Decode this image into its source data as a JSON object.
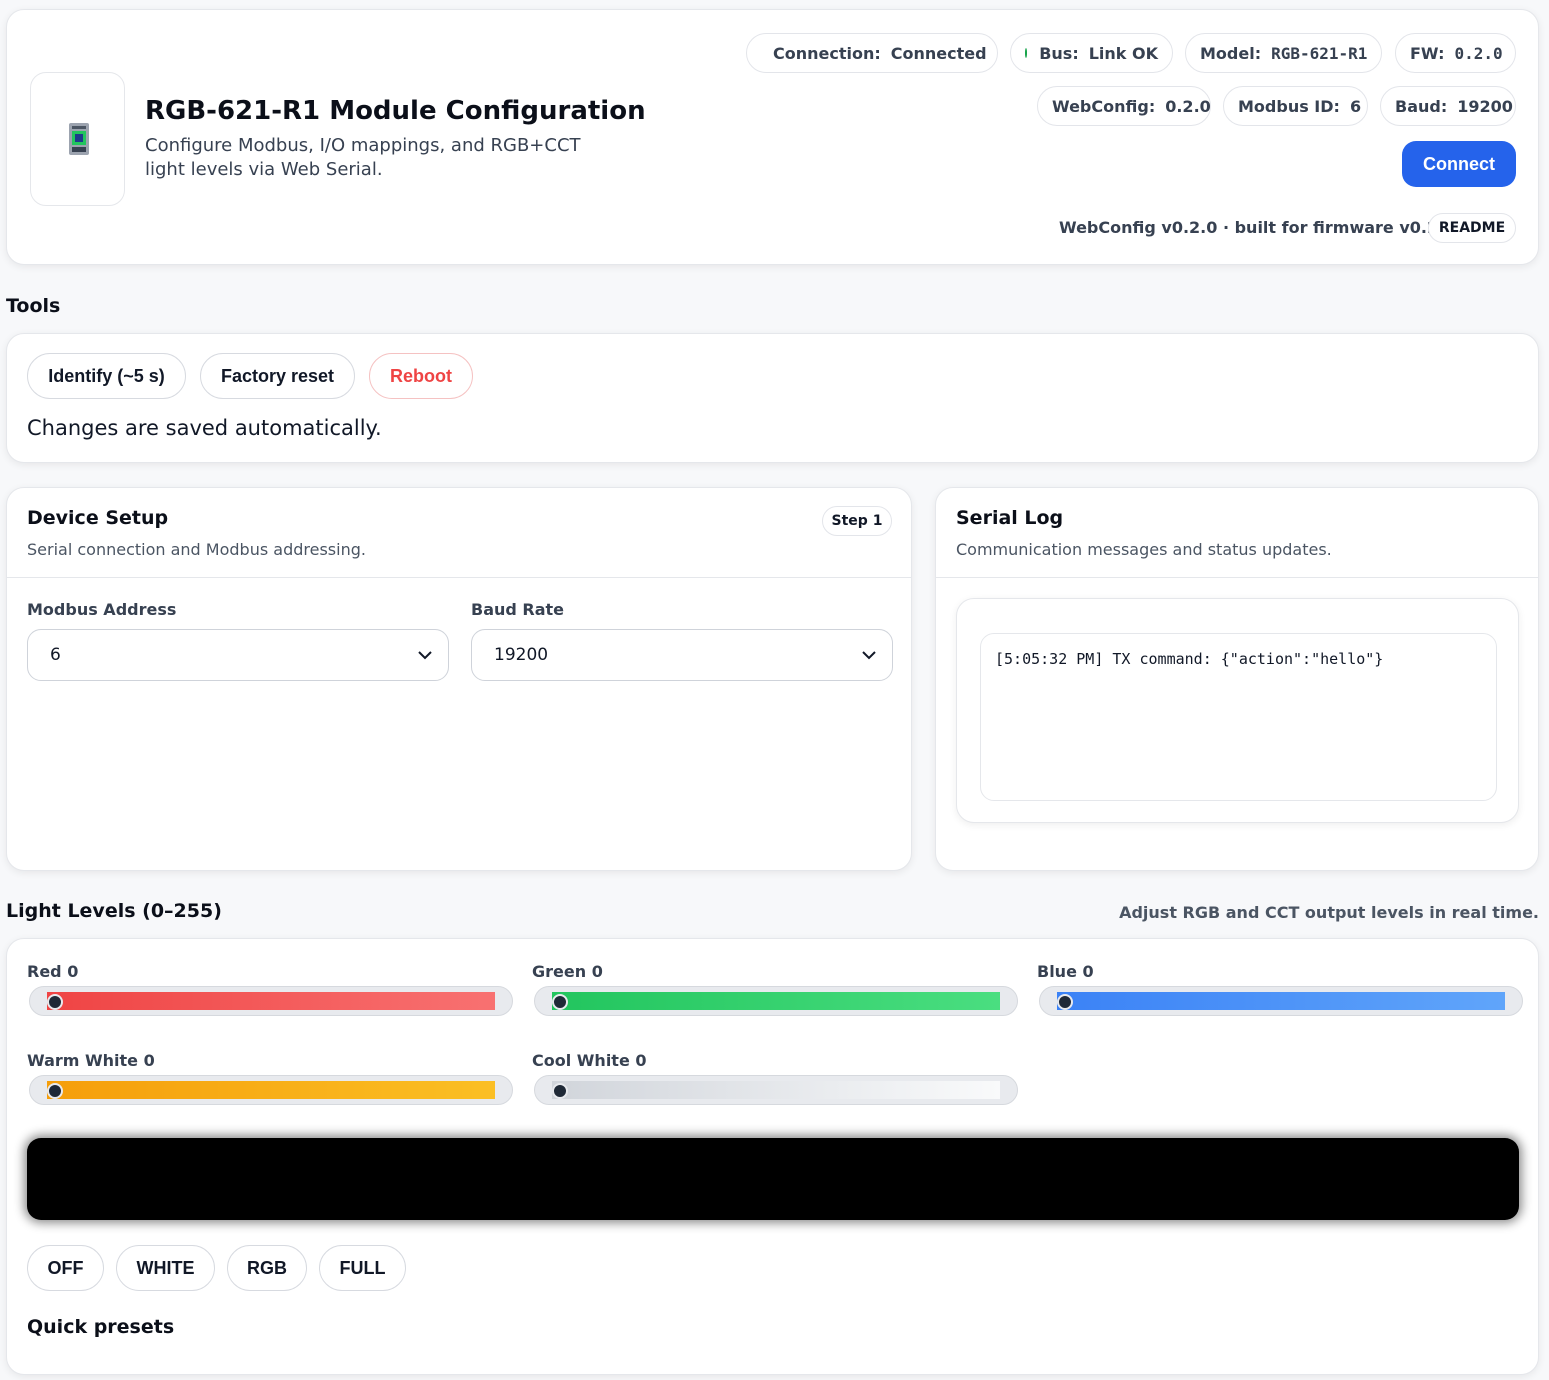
{
  "header": {
    "title": "RGB-621-R1 Module Configuration",
    "subtitle_line1": "Configure Modbus, I/O mappings, and RGB+CCT",
    "subtitle_line2": "light levels via Web Serial.",
    "status": {
      "connection_label": "Connection:",
      "connection_value": "Connected",
      "bus_label": "Bus:",
      "bus_value": "Link OK",
      "model_label": "Model:",
      "model_value": "RGB-621-R1",
      "fw_label": "FW:",
      "fw_value": "0.2.0",
      "webconfig_label": "WebConfig:",
      "webconfig_value": "0.2.0",
      "modbus_label": "Modbus ID:",
      "modbus_value": "6",
      "baud_label": "Baud:",
      "baud_value": "19200"
    },
    "connect_label": "Connect",
    "build_info": "WebConfig v0.2.0 · built for firmware v0.2.0",
    "readme_label": "README"
  },
  "tools": {
    "title": "Tools",
    "identify_label": "Identify (~5 s)",
    "factory_reset_label": "Factory reset",
    "reboot_label": "Reboot",
    "note": "Changes are saved automatically."
  },
  "device_setup": {
    "title": "Device Setup",
    "step_badge": "Step 1",
    "subtitle": "Serial connection and Modbus addressing.",
    "modbus_address_label": "Modbus Address",
    "modbus_address_value": "6",
    "baud_rate_label": "Baud Rate",
    "baud_rate_value": "19200"
  },
  "serial_log": {
    "title": "Serial Log",
    "subtitle": "Communication messages and status updates.",
    "lines": [
      "[5:05:32 PM] TX command: {\"action\":\"hello\"}"
    ]
  },
  "light_levels": {
    "title": "Light Levels (0–255)",
    "hint": "Adjust RGB and CCT output levels in real time.",
    "sliders": [
      {
        "label": "Red 0",
        "value": 0
      },
      {
        "label": "Green 0",
        "value": 0
      },
      {
        "label": "Blue 0",
        "value": 0
      },
      {
        "label": "Warm White 0",
        "value": 0
      },
      {
        "label": "Cool White 0",
        "value": 0
      }
    ],
    "preview_color": "#000000",
    "presets": [
      "OFF",
      "WHITE",
      "RGB",
      "FULL"
    ],
    "presets_title": "Quick presets"
  },
  "colors": {
    "accent": "#2563eb",
    "status_ok": "#16a34a",
    "danger": "#ef4444",
    "red": "#ef4444",
    "green": "#22c55e",
    "blue": "#3b82f6",
    "warm_white": "#f59e0b",
    "cool_white": "#d1d5db"
  },
  "icons": {
    "device": "module-chip-icon",
    "select_arrow": "chevron-down-icon"
  }
}
